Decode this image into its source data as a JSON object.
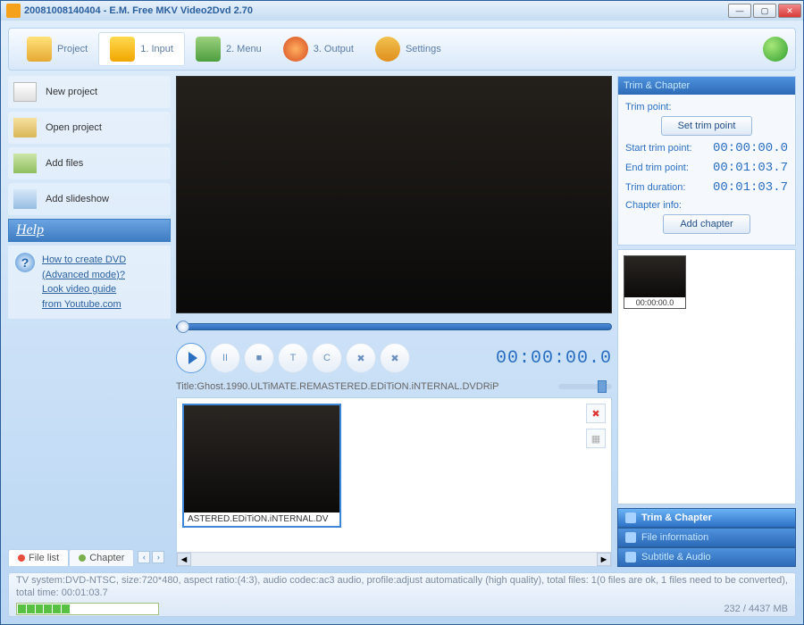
{
  "titlebar": {
    "text": "20081008140404 - E.M. Free MKV Video2Dvd 2.70"
  },
  "nav": {
    "project": "Project",
    "input": "1. Input",
    "menu": "2. Menu",
    "output": "3. Output",
    "settings": "Settings"
  },
  "side": {
    "new": "New project",
    "open": "Open project",
    "addfiles": "Add files",
    "addslides": "Add slideshow"
  },
  "help": {
    "header": "Help",
    "link1a": "How to create DVD",
    "link1b": "(Advanced mode)?",
    "link2a": "Look video guide",
    "link2b": "from Youtube.com"
  },
  "player": {
    "time": "00:00:00.0",
    "title_label": "Title:Ghost.1990.ULTiMATE.REMASTERED.EDiTiON.iNTERNAL.DVDRiP"
  },
  "tabs": {
    "filelist": "File list",
    "chapter": "Chapter"
  },
  "thumb_caption": "ASTERED.EDiTiON.iNTERNAL.DV",
  "trim": {
    "header": "Trim & Chapter",
    "trim_point_label": "Trim point:",
    "set_btn": "Set trim point",
    "start_label": "Start trim point:",
    "start_val": "00:00:00.0",
    "end_label": "End trim point:",
    "end_val": "00:01:03.7",
    "dur_label": "Trim duration:",
    "dur_val": "00:01:03.7",
    "chapter_info": "Chapter info:",
    "add_chapter": "Add chapter",
    "chapter_thumb_tc": "00:00:00.0"
  },
  "stack": {
    "trim": "Trim & Chapter",
    "fileinfo": "File information",
    "subaudio": "Subtitle & Audio"
  },
  "status": {
    "line": "TV system:DVD-NTSC, size:720*480, aspect ratio:(4:3), audio codec:ac3 audio, profile:adjust automatically (high quality), total files: 1(0 files are ok, 1 files need to be converted), total time: 00:01:03.7",
    "disk": "232 / 4437 MB"
  }
}
